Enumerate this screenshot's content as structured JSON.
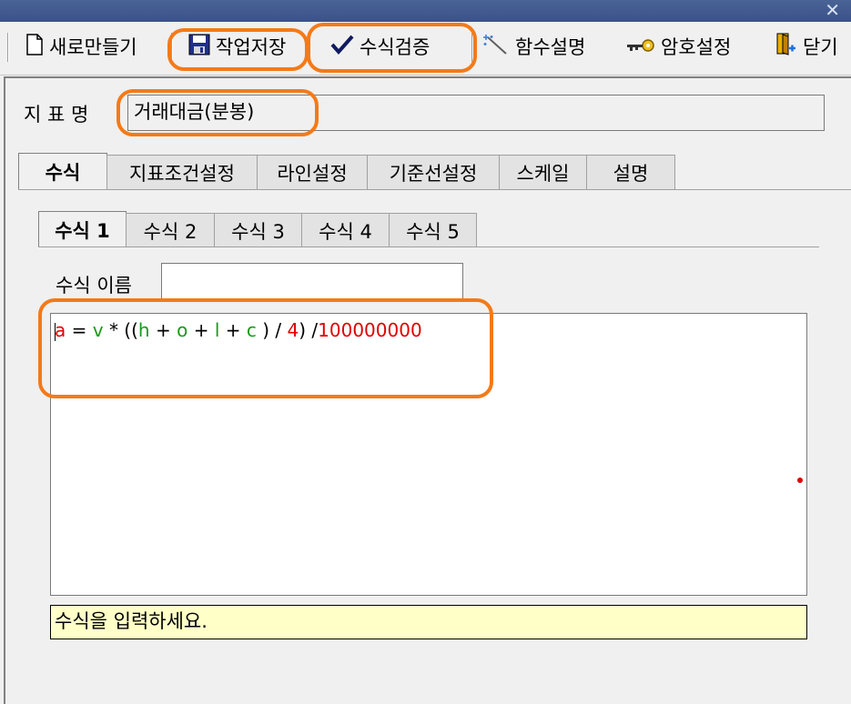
{
  "window": {
    "close_glyph": "✕"
  },
  "toolbar": {
    "new": "새로만들기",
    "save": "작업저장",
    "verify": "수식검증",
    "functions": "함수설명",
    "password": "암호설정",
    "close": "닫기"
  },
  "indicator": {
    "name_label": "지 표 명",
    "name_value": "거래대금(분봉)"
  },
  "main_tabs": [
    "수식",
    "지표조건설정",
    "라인설정",
    "기준선설정",
    "스케일",
    "설명"
  ],
  "formula_tabs": [
    "수식 1",
    "수식 2",
    "수식 3",
    "수식 4",
    "수식 5"
  ],
  "formula_name_label": "수식 이름",
  "formula_name_value": "",
  "formula_tokens": [
    {
      "t": "a",
      "c": "red"
    },
    {
      "t": " = ",
      "c": "black"
    },
    {
      "t": "v",
      "c": "green"
    },
    {
      "t": " * ((",
      "c": "black"
    },
    {
      "t": "h",
      "c": "green"
    },
    {
      "t": " + ",
      "c": "black"
    },
    {
      "t": "o",
      "c": "green"
    },
    {
      "t": " + ",
      "c": "black"
    },
    {
      "t": "l",
      "c": "green"
    },
    {
      "t": " + ",
      "c": "black"
    },
    {
      "t": "c",
      "c": "green"
    },
    {
      "t": " ) / ",
      "c": "black"
    },
    {
      "t": "4",
      "c": "red"
    },
    {
      "t": ") /",
      "c": "black"
    },
    {
      "t": "100000000",
      "c": "red"
    }
  ],
  "status_message": "수식을 입력하세요.",
  "colors": {
    "highlight": "#f47a18",
    "titlebar": "#3b5998",
    "status_bg": "#ffffc8"
  }
}
